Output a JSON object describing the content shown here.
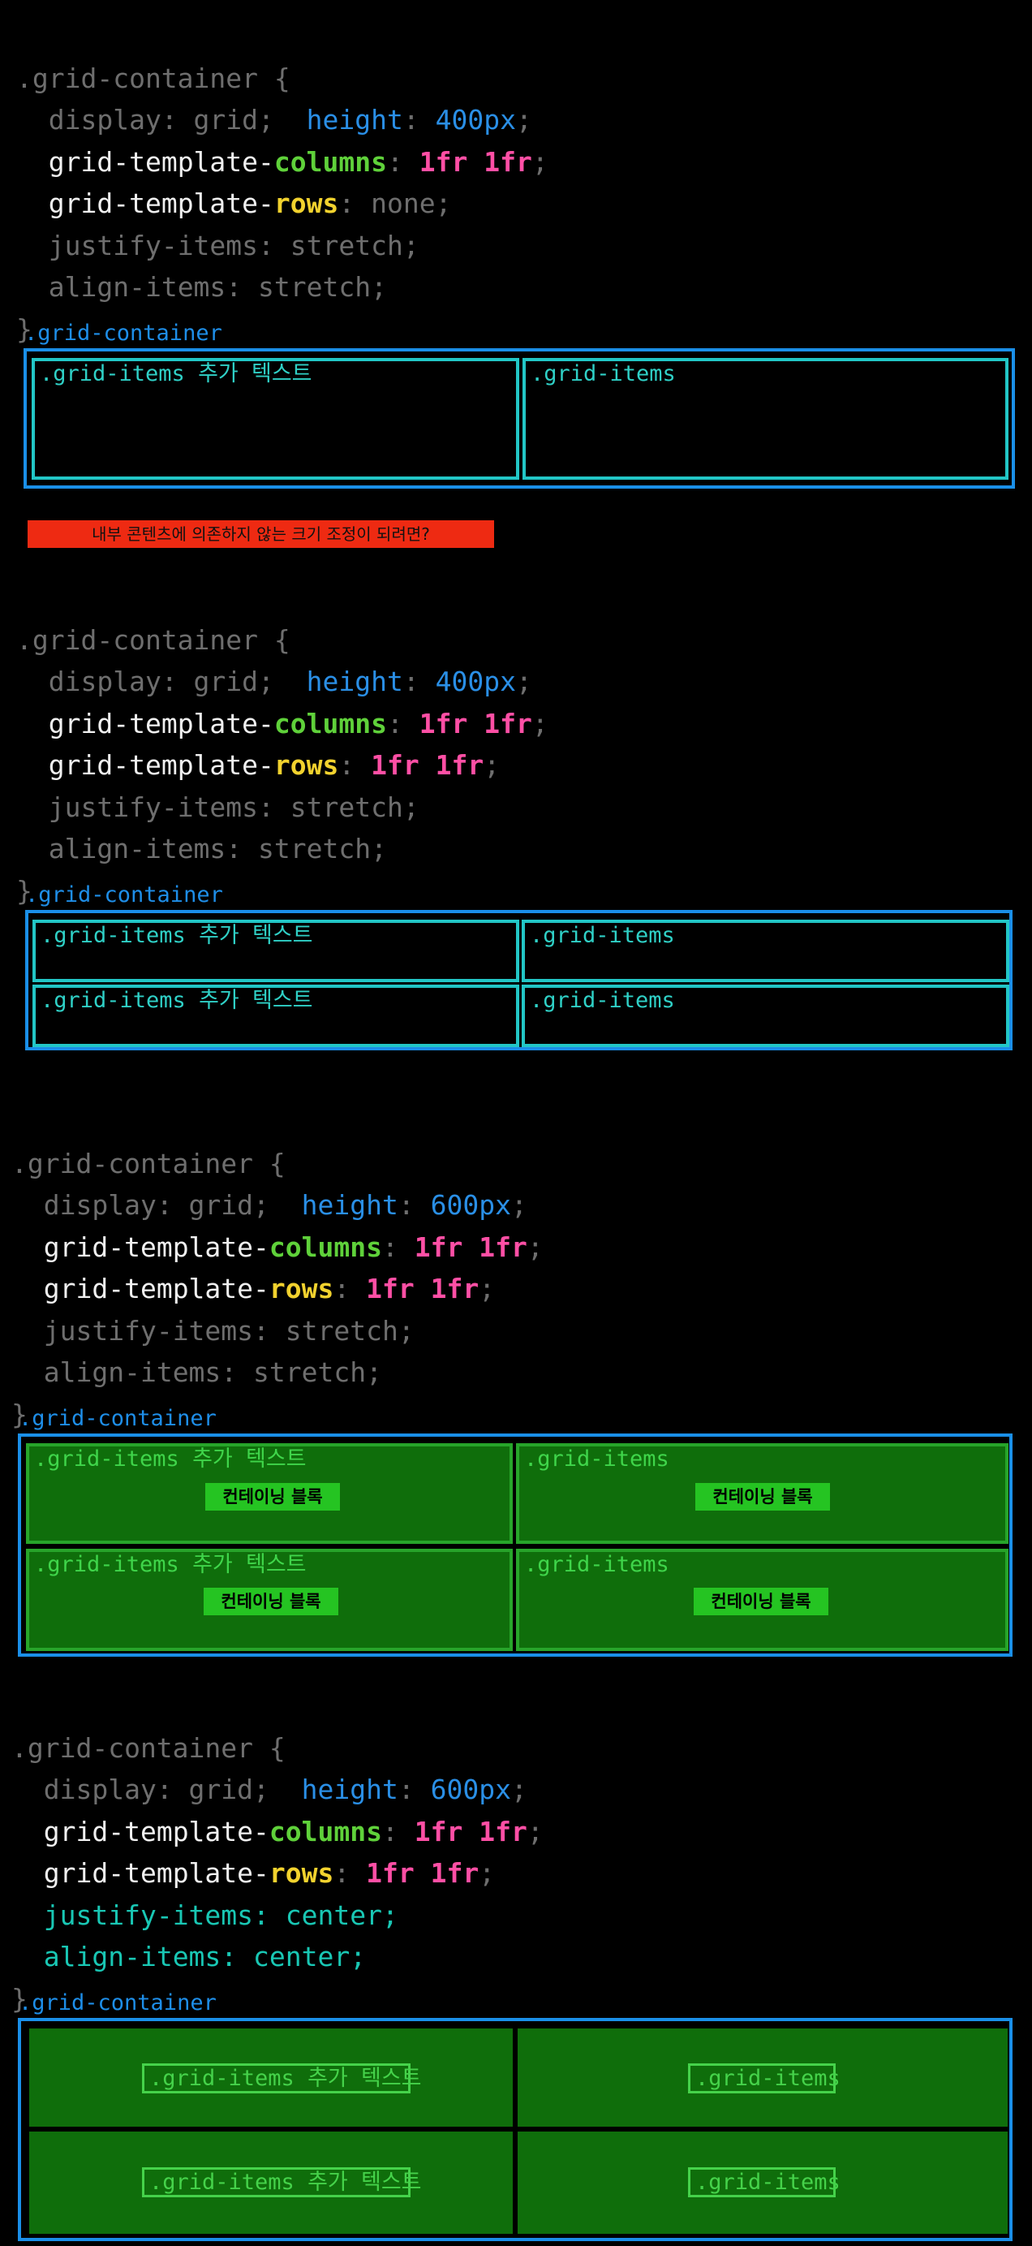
{
  "code_blocks": [
    {
      "selector": ".grid-container {",
      "display": "display: grid;",
      "height_prop": "height",
      "height_val": "400px",
      "cols_prop_a": "grid-template-",
      "cols_prop_b": "columns",
      "cols_val": "1fr 1fr",
      "rows_prop_a": "grid-template-",
      "rows_prop_b": "rows",
      "rows_val": "none",
      "justify": "justify-items: stretch;",
      "align": "align-items: stretch;",
      "close": "}"
    },
    {
      "selector": ".grid-container {",
      "display": "display: grid;",
      "height_prop": "height",
      "height_val": "400px",
      "cols_prop_a": "grid-template-",
      "cols_prop_b": "columns",
      "cols_val": "1fr 1fr",
      "rows_prop_a": "grid-template-",
      "rows_prop_b": "rows",
      "rows_val": "1fr 1fr",
      "justify": "justify-items: stretch;",
      "align": "align-items: stretch;",
      "close": "}"
    },
    {
      "selector": ".grid-container {",
      "display": "display: grid;",
      "height_prop": "height",
      "height_val": "600px",
      "cols_prop_a": "grid-template-",
      "cols_prop_b": "columns",
      "cols_val": "1fr 1fr",
      "rows_prop_a": "grid-template-",
      "rows_prop_b": "rows",
      "rows_val": "1fr 1fr",
      "justify": "justify-items: stretch;",
      "align": "align-items: stretch;",
      "close": "}"
    },
    {
      "selector": ".grid-container {",
      "display": "display: grid;",
      "height_prop": "height",
      "height_val": "600px",
      "cols_prop_a": "grid-template-",
      "cols_prop_b": "columns",
      "cols_val": "1fr 1fr",
      "rows_prop_a": "grid-template-",
      "rows_prop_b": "rows",
      "rows_val": "1fr 1fr",
      "justify": "justify-items: center;",
      "align": "align-items: center;",
      "close": "}"
    }
  ],
  "container_label": ".grid-container",
  "item_with_text": ".grid-items 추가 텍스트",
  "item_plain": ".grid-items",
  "banner": "내부 콘텐츠에 의존하지 않는 크기 조정이 되려면?",
  "block_label": "컨테이닝 블록",
  "colors": {
    "background": "#000000",
    "container_border": "#1a8fe8",
    "item_border": "#22c6c6",
    "green_fill": "#0f6e0b",
    "block_fill": "#25c422",
    "banner_fill": "#ee2a12"
  }
}
